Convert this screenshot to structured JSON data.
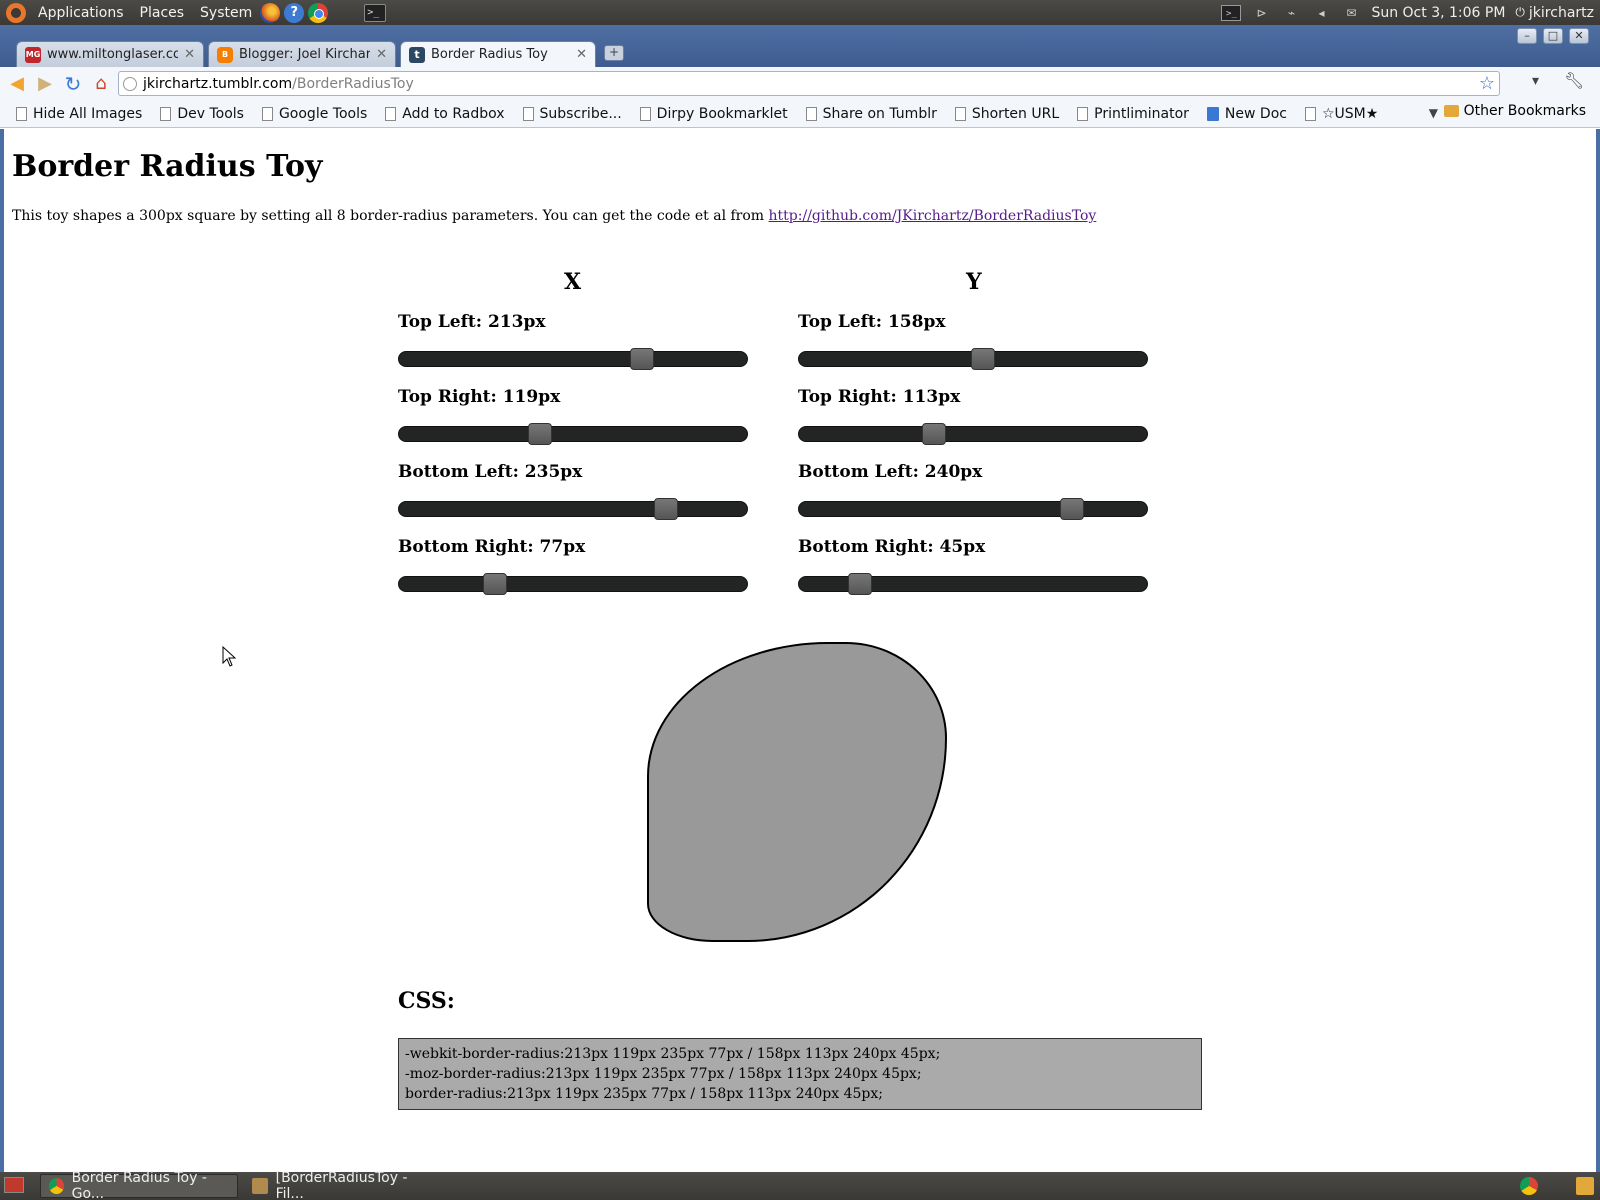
{
  "top_panel": {
    "menus": [
      "Applications",
      "Places",
      "System"
    ],
    "launchers": [
      "firefox-icon",
      "help-icon",
      "chrome-icon",
      "terminal-icon"
    ],
    "clock": "Sun Oct  3,  1:06 PM",
    "user": "jkirchartz"
  },
  "browser": {
    "tabs": [
      {
        "title": "www.miltonglaser.co...",
        "favicon": "mg-favicon"
      },
      {
        "title": "Blogger: Joel Kirchart...",
        "favicon": "blogger-favicon"
      },
      {
        "title": "Border Radius Toy",
        "favicon": "tumblr-favicon",
        "active": true
      }
    ],
    "address": {
      "host": "jkirchartz.tumblr.com",
      "path": "/BorderRadiusToy"
    },
    "bookmarks": [
      "Hide All Images",
      "Dev Tools",
      "Google Tools",
      "Add to Radbox",
      "Subscribe...",
      "Dirpy Bookmarklet",
      "Share on Tumblr",
      "Shorten URL",
      "Printliminator",
      "New Doc",
      "☆USM★"
    ],
    "other_bookmarks": "Other Bookmarks"
  },
  "page": {
    "title": "Border Radius Toy",
    "intro_text": "This toy shapes a 300px square by setting all 8 border-radius parameters. You can get the code et al from ",
    "intro_link": "http://github.com/JKirchartz/BorderRadiusToy",
    "col_x": "X",
    "col_y": "Y",
    "slider_max": 300,
    "x_sliders": [
      {
        "label": "Top Left: 213px",
        "value": 213
      },
      {
        "label": "Top Right: 119px",
        "value": 119
      },
      {
        "label": "Bottom Left: 235px",
        "value": 235
      },
      {
        "label": "Bottom Right: 77px",
        "value": 77
      }
    ],
    "y_sliders": [
      {
        "label": "Top Left: 158px",
        "value": 158
      },
      {
        "label": "Top Right: 113px",
        "value": 113
      },
      {
        "label": "Bottom Left: 240px",
        "value": 240
      },
      {
        "label": "Bottom Right: 45px",
        "value": 45
      }
    ],
    "css_heading": "CSS:",
    "css_lines": [
      "-webkit-border-radius:213px 119px 235px 77px / 158px 113px 240px 45px;",
      "-moz-border-radius:213px 119px 235px 77px / 158px 113px 240px 45px;",
      "border-radius:213px 119px 235px 77px / 158px 113px 240px 45px;"
    ],
    "shape_color": "#999999"
  },
  "bottom_panel": {
    "tasks": [
      "Border Radius Toy - Go...",
      "[BorderRadiusToy - Fil..."
    ]
  }
}
